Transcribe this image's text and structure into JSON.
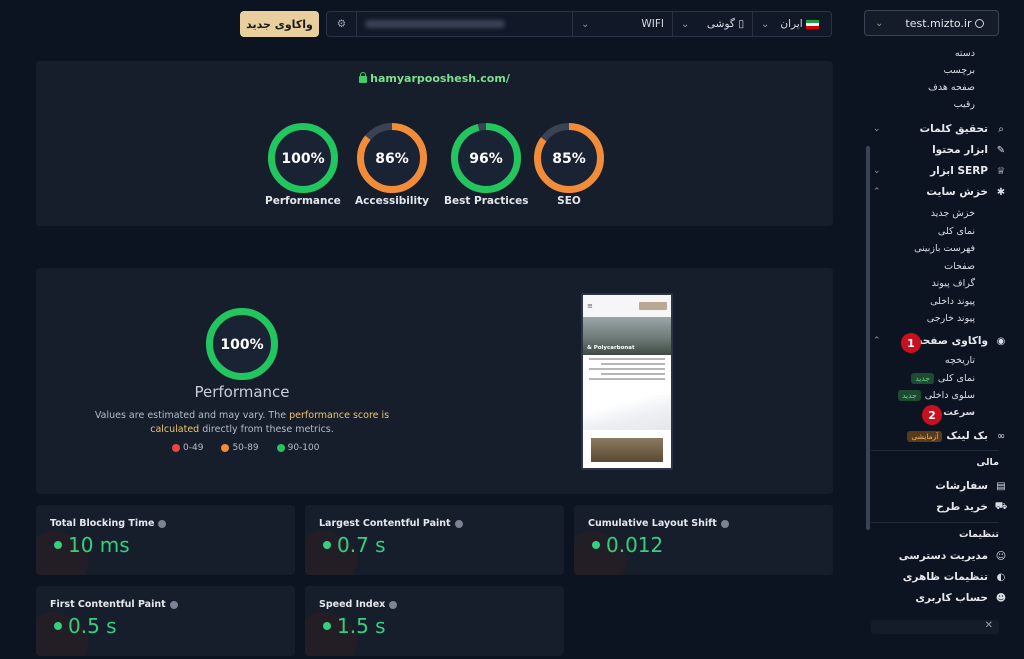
{
  "toolbar": {
    "new_analysis": "واکاوی جدید",
    "network": "WIFI",
    "device": "گوشی",
    "country": "ایران"
  },
  "site_selector": {
    "value": "test.mizto.ir"
  },
  "report": {
    "url": "hamyarpooshesh.com/",
    "scores": [
      {
        "label": "Performance",
        "value": 100,
        "display": "100%",
        "color": "#22c55e"
      },
      {
        "label": "Accessibility",
        "value": 86,
        "display": "86%",
        "color": "#f28c38"
      },
      {
        "label": "Best Practices",
        "value": 96,
        "display": "96%",
        "color": "#22c55e"
      },
      {
        "label": "SEO",
        "value": 85,
        "display": "85%",
        "color": "#f28c38"
      }
    ]
  },
  "performance": {
    "value": 100,
    "display": "100%",
    "title": "Performance",
    "note_start": "Values are estimated and may vary. The ",
    "note_link": "performance score is calculated",
    "note_end": " directly from these metrics.",
    "legend": [
      {
        "label": "0-49",
        "color": "#ef4444"
      },
      {
        "label": "50-89",
        "color": "#f28c38"
      },
      {
        "label": "90-100",
        "color": "#22c55e"
      }
    ]
  },
  "screenshot": {
    "hero_text": "& Polycarbonat"
  },
  "metrics": [
    {
      "title": "Total Blocking Time",
      "value": "10 ms"
    },
    {
      "title": "Largest Contentful Paint",
      "value": "0.7 s"
    },
    {
      "title": "Cumulative Layout Shift",
      "value": "0.012"
    },
    {
      "title": "First Contentful Paint",
      "value": "0.5 s"
    },
    {
      "title": "Speed Index",
      "value": "1.5 s"
    }
  ],
  "sidebar": {
    "top_subitems": [
      "دسته",
      "برچسب",
      "صفحه هدف",
      "رقیب"
    ],
    "keyword_research": "تحقیق کلمات",
    "content_tools": "ابزار محتوا",
    "serp_tools": "ابزار SERP",
    "site_crawl": "خزش سایت",
    "crawl_items": [
      "خزش جدید",
      "نمای کلی",
      "فهرست بازبینی",
      "صفحات",
      "گراف پیوند",
      "پیوند داخلی",
      "پیوند خارجی"
    ],
    "page_analysis": "واکاوی صفحه",
    "history": "تاریخچه",
    "overview": "نمای کلی",
    "internal_level": "سلوی داخلی",
    "speed": "سرعت",
    "backlink": "بک لینک",
    "badge_new": "جدید",
    "badge_trial": "آزمایشی",
    "finance_title": "مالی",
    "orders": "سفارشات",
    "buy_plan": "خرید طرح",
    "settings_title": "تنظیمات",
    "access_mgmt": "مدیریت دسترسی",
    "appearance": "تنظیمات ظاهری",
    "user_account": "حساب کاربری",
    "marker_1": "1",
    "marker_2": "2"
  }
}
